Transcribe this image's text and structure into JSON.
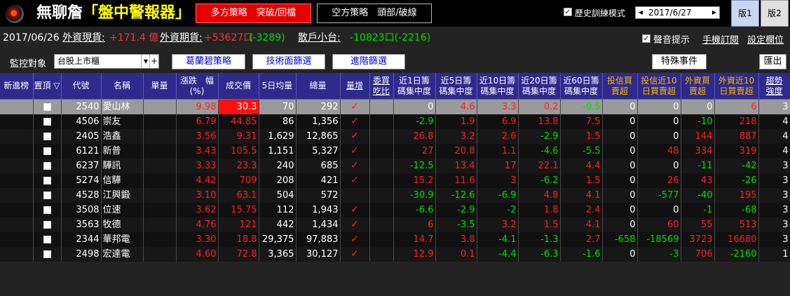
{
  "app": {
    "title_main": "無聊詹",
    "title_sub": "「盤中警報器」",
    "btn_long": "多方策略　突破/回檔",
    "btn_short": "空方策略　頭部/破線",
    "history_label": "歷史訓練模式",
    "date_value": "2017/6/27",
    "ver1": "版1",
    "ver2": "版2"
  },
  "info": {
    "date": "2017/06/26",
    "foreign_spot_label": "外資現貨:",
    "foreign_spot_value": "+171.4 億",
    "foreign_fut_label": "外資期貨:",
    "foreign_fut_value": "+53627口",
    "foreign_fut_change": "(-3289)",
    "retail_label": "散戶小台:",
    "retail_value": "-10823口(-2216)",
    "sound_label": "聲音提示",
    "manual_sub": "手機訂閱",
    "settings": "設定欄位"
  },
  "filter": {
    "label": "監控對象",
    "market": "台股上市櫃",
    "plus": "+",
    "btn_strategy": "葛蘭碧策略",
    "btn_tech": "技術面篩選",
    "btn_adv": "進階篩選",
    "btn_special": "特殊事件",
    "btn_export": "匯出"
  },
  "headers": [
    "新進榜",
    "置頂 ▽",
    "代號",
    "名稱",
    "單量",
    "漲跌　幅 (%)",
    "成交價",
    "5日均量",
    "總量",
    "量增",
    "委買 吃比",
    "近1日籌 碼集中度",
    "近5日籌 碼集中度",
    "近10日籌 碼集中度",
    "近20日籌 碼集中度",
    "近60日籌 碼集中度",
    "投信買 賣超",
    "投信近10 日買賣超",
    "外資買 賣超",
    "外資近10 日買賣超",
    "趨勢 強度"
  ],
  "rows": [
    {
      "code": "2540",
      "name": "愛山林",
      "unit": "",
      "chg": "9.98",
      "price": "30.3",
      "avg5": "70",
      "total": "292",
      "vol": "✓",
      "bid": "",
      "c1": "0",
      "c5": "4.6",
      "c10": "3.3",
      "c20": "0.2",
      "c60": "-0.5",
      "it": "0",
      "it10": "0",
      "fi": "0",
      "fi10": "6",
      "trend": "3"
    },
    {
      "code": "4506",
      "name": "崇友",
      "unit": "",
      "chg": "6.79",
      "price": "44.85",
      "avg5": "86",
      "total": "1,356",
      "vol": "✓",
      "bid": "",
      "c1": "-2.9",
      "c5": "1.9",
      "c10": "6.9",
      "c20": "13.8",
      "c60": "7.5",
      "it": "0",
      "it10": "0",
      "fi": "-10",
      "fi10": "218",
      "trend": "4"
    },
    {
      "code": "2405",
      "name": "浩鑫",
      "unit": "",
      "chg": "3.56",
      "price": "9.31",
      "avg5": "1,629",
      "total": "12,865",
      "vol": "✓",
      "bid": "",
      "c1": "26.8",
      "c5": "3.2",
      "c10": "2.6",
      "c20": "-2.9",
      "c60": "1.5",
      "it": "0",
      "it10": "0",
      "fi": "144",
      "fi10": "887",
      "trend": "4"
    },
    {
      "code": "6121",
      "name": "新普",
      "unit": "",
      "chg": "3.43",
      "price": "105.5",
      "avg5": "1,151",
      "total": "5,327",
      "vol": "✓",
      "bid": "",
      "c1": "27",
      "c5": "20.8",
      "c10": "1.1",
      "c20": "-4.6",
      "c60": "-5.5",
      "it": "0",
      "it10": "48",
      "fi": "334",
      "fi10": "319",
      "trend": "4"
    },
    {
      "code": "6237",
      "name": "驊訊",
      "unit": "",
      "chg": "3.33",
      "price": "23.3",
      "avg5": "240",
      "total": "685",
      "vol": "✓",
      "bid": "",
      "c1": "-12.5",
      "c5": "13.4",
      "c10": "17",
      "c20": "22.1",
      "c60": "4.4",
      "it": "0",
      "it10": "0",
      "fi": "-11",
      "fi10": "-42",
      "trend": "3"
    },
    {
      "code": "5274",
      "name": "信驊",
      "unit": "",
      "chg": "4.42",
      "price": "709",
      "avg5": "208",
      "total": "421",
      "vol": "✓",
      "bid": "",
      "c1": "15.2",
      "c5": "11.6",
      "c10": "3",
      "c20": "-6.2",
      "c60": "1.5",
      "it": "0",
      "it10": "26",
      "fi": "43",
      "fi10": "-26",
      "trend": "3"
    },
    {
      "code": "4528",
      "name": "江興鍛",
      "unit": "",
      "chg": "3.10",
      "price": "63.1",
      "avg5": "504",
      "total": "572",
      "vol": "",
      "bid": "",
      "c1": "-30.9",
      "c5": "-12.6",
      "c10": "-6.9",
      "c20": "4.8",
      "c60": "4.1",
      "it": "0",
      "it10": "-577",
      "fi": "-40",
      "fi10": "195",
      "trend": "3"
    },
    {
      "code": "3508",
      "name": "位速",
      "unit": "",
      "chg": "3.62",
      "price": "15.75",
      "avg5": "112",
      "total": "1,943",
      "vol": "✓",
      "bid": "",
      "c1": "-6.6",
      "c5": "-2.9",
      "c10": "-2",
      "c20": "1.8",
      "c60": "2.4",
      "it": "0",
      "it10": "0",
      "fi": "-1",
      "fi10": "-68",
      "trend": "3"
    },
    {
      "code": "3563",
      "name": "牧德",
      "unit": "",
      "chg": "4.76",
      "price": "121",
      "avg5": "442",
      "total": "1,434",
      "vol": "✓",
      "bid": "",
      "c1": "6",
      "c5": "-3.5",
      "c10": "3.2",
      "c20": "1.5",
      "c60": "4.1",
      "it": "0",
      "it10": "60",
      "fi": "55",
      "fi10": "513",
      "trend": "3"
    },
    {
      "code": "2344",
      "name": "華邦電",
      "unit": "",
      "chg": "3.30",
      "price": "18.8",
      "avg5": "29,375",
      "total": "97,883",
      "vol": "✓",
      "bid": "",
      "c1": "14.7",
      "c5": "3.8",
      "c10": "-4.1",
      "c20": "-1.3",
      "c60": "2.7",
      "it": "-658",
      "it10": "-18569",
      "fi": "3723",
      "fi10": "16680",
      "trend": "3"
    },
    {
      "code": "2498",
      "name": "宏達電",
      "unit": "",
      "chg": "4.60",
      "price": "72.8",
      "avg5": "3,365",
      "total": "30,127",
      "vol": "✓",
      "bid": "",
      "c1": "12.9",
      "c5": "0.1",
      "c10": "-4.4",
      "c20": "-6.3",
      "c60": "-1.6",
      "it": "0",
      "it10": "-3",
      "fi": "706",
      "fi10": "-2160",
      "trend": "1"
    }
  ]
}
